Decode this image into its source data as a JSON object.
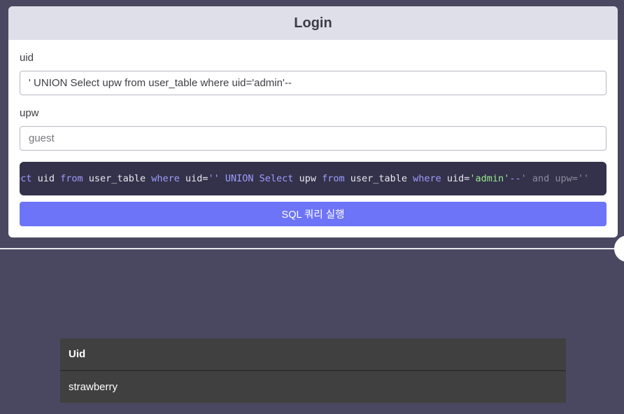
{
  "login": {
    "title": "Login",
    "uid_label": "uid",
    "uid_value": "' UNION Select upw from user_table where uid='admin'--",
    "upw_label": "upw",
    "upw_placeholder": "guest",
    "button_label": "SQL 쿼리 실행"
  },
  "query": {
    "tokens": [
      {
        "text": "lect",
        "kind": "kw"
      },
      {
        "text": " uid ",
        "kind": "plain"
      },
      {
        "text": "from",
        "kind": "kw"
      },
      {
        "text": " user_table ",
        "kind": "plain"
      },
      {
        "text": "where",
        "kind": "kw"
      },
      {
        "text": " uid=",
        "kind": "plain"
      },
      {
        "text": "''",
        "kind": "kw"
      },
      {
        "text": " UNION Select ",
        "kind": "kw"
      },
      {
        "text": "upw ",
        "kind": "plain"
      },
      {
        "text": "from",
        "kind": "kw"
      },
      {
        "text": " user_table ",
        "kind": "plain"
      },
      {
        "text": "where",
        "kind": "kw"
      },
      {
        "text": " uid=",
        "kind": "plain"
      },
      {
        "text": "'admin'",
        "kind": "str"
      },
      {
        "text": "--",
        "kind": "kw"
      },
      {
        "text": "' and upw=''",
        "kind": "dim"
      }
    ]
  },
  "results": {
    "header": "Uid",
    "rows": [
      "strawberry"
    ]
  },
  "colors": {
    "accent": "#6d74f7",
    "background": "#4a4860",
    "code_bg": "#33324a"
  }
}
